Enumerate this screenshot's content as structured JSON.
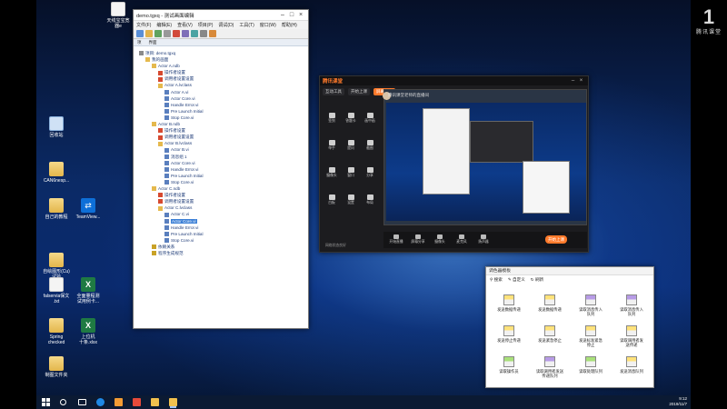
{
  "watermark": {
    "main": "1",
    "sub": "腾讯课堂"
  },
  "desktop_icons": [
    {
      "label": "天线宝宝宽\n器e",
      "type": "doc"
    },
    {
      "label": "回收站",
      "type": "recycle"
    },
    {
      "label": "CAN6nesp...",
      "type": "folder"
    },
    {
      "label": "自己的教程",
      "type": "folder"
    },
    {
      "label": "TeamView...",
      "type": "tv"
    },
    {
      "label": "自绘图形(Cu)\n试验",
      "type": "folder"
    },
    {
      "label": "falservia保文\n.txt",
      "type": "doc"
    },
    {
      "label": "全面量程测\n试用例卡...",
      "type": "excel"
    },
    {
      "label": "Spring\nchecked",
      "type": "folder"
    },
    {
      "label": "上位机\n十条.xlsx",
      "type": "excel"
    },
    {
      "label": "制图文件夹",
      "type": "folder"
    }
  ],
  "tree_window": {
    "title": "demo.tgxq - 测试画面编辑",
    "menus": [
      "文件(F)",
      "编辑(E)",
      "查看(V)",
      "项目(P)",
      "调试(D)",
      "工具(T)",
      "窗口(W)",
      "帮助(H)"
    ],
    "tabs": [
      "项",
      "界面"
    ],
    "nodes": [
      {
        "depth": 0,
        "label": "项目: demo.tgxq",
        "icon": "root"
      },
      {
        "depth": 1,
        "label": "我的画面",
        "icon": "folder"
      },
      {
        "depth": 2,
        "label": "Actor A.ndb",
        "icon": "folder"
      },
      {
        "depth": 3,
        "label": "操作者设置",
        "icon": "flag"
      },
      {
        "depth": 3,
        "label": "调用者设置设置",
        "icon": "flag"
      },
      {
        "depth": 3,
        "label": "Actor A.lvclass",
        "icon": "folder"
      },
      {
        "depth": 4,
        "label": "Actor A.vi",
        "icon": "leaf"
      },
      {
        "depth": 4,
        "label": "Actor Core.vi",
        "icon": "leaf"
      },
      {
        "depth": 4,
        "label": "Handle Error.vi",
        "icon": "leaf"
      },
      {
        "depth": 4,
        "label": "Pre Launch Initial",
        "icon": "leaf"
      },
      {
        "depth": 4,
        "label": "Stop Core.vi",
        "icon": "leaf"
      },
      {
        "depth": 2,
        "label": "Actor B.ndb",
        "icon": "folder"
      },
      {
        "depth": 3,
        "label": "操作者设置",
        "icon": "flag"
      },
      {
        "depth": 3,
        "label": "调用者设置设置",
        "icon": "flag"
      },
      {
        "depth": 3,
        "label": "Actor B.lvclass",
        "icon": "folder"
      },
      {
        "depth": 4,
        "label": "Actor B.vi",
        "icon": "leaf"
      },
      {
        "depth": 4,
        "label": "消息组 1",
        "icon": "leaf"
      },
      {
        "depth": 4,
        "label": "Actor Core.vi",
        "icon": "leaf"
      },
      {
        "depth": 4,
        "label": "Handle Error.vi",
        "icon": "leaf"
      },
      {
        "depth": 4,
        "label": "Pre Launch Initial",
        "icon": "leaf"
      },
      {
        "depth": 4,
        "label": "Stop Core.vi",
        "icon": "leaf"
      },
      {
        "depth": 2,
        "label": "Actor C.ndb",
        "icon": "folder"
      },
      {
        "depth": 3,
        "label": "操作者设置",
        "icon": "flag"
      },
      {
        "depth": 3,
        "label": "调用者设置设置",
        "icon": "flag"
      },
      {
        "depth": 3,
        "label": "Actor C.lvclass",
        "icon": "folder"
      },
      {
        "depth": 4,
        "label": "Actor C.vi",
        "icon": "leaf"
      },
      {
        "depth": 4,
        "label": "Actor Core.vi",
        "icon": "leaf",
        "selected": true
      },
      {
        "depth": 4,
        "label": "Handle Error.vi",
        "icon": "leaf"
      },
      {
        "depth": 4,
        "label": "Pre Launch Initial",
        "icon": "leaf"
      },
      {
        "depth": 4,
        "label": "Stop Core.vi",
        "icon": "leaf"
      },
      {
        "depth": 2,
        "label": "依赖关系",
        "icon": "star"
      },
      {
        "depth": 2,
        "label": "程序生成规范",
        "icon": "star"
      }
    ]
  },
  "rec_window": {
    "app_name": "腾讯课堂",
    "nav": [
      "互动工具",
      "开始上课",
      "屏幕分享"
    ],
    "nav_active": 2,
    "streamer": "腾讯课堂老师的直播间",
    "sidebar_tools": [
      "签到",
      "答题卡",
      "画中画",
      "举手",
      "提问",
      "截图",
      "摄像头",
      "窗口",
      "分享",
      "白板",
      "设置",
      "布局"
    ],
    "bottom_tools": [
      "开始直播",
      "屏幕分享",
      "摄像头",
      "麦克风",
      "扬声器"
    ],
    "live_label": "开始上课",
    "status": "网络状态良好"
  },
  "tool_panel": {
    "title": "调色器模板",
    "tools": [
      "搜索",
      "自定义",
      "刷新"
    ],
    "items": [
      {
        "label": "发送数据传递",
        "color": "yellow"
      },
      {
        "label": "发送数据传递",
        "color": "yellow"
      },
      {
        "label": "读取消息传入\n队列",
        "color": "purple"
      },
      {
        "label": "读取消息传入\n队列",
        "color": "purple"
      },
      {
        "label": "发送停止传递",
        "color": "yellow"
      },
      {
        "label": "发送紧急停止",
        "color": "yellow"
      },
      {
        "label": "发送标准紧急\n停止",
        "color": "yellow"
      },
      {
        "label": "读取调用者发\n送传递",
        "color": "yellow"
      },
      {
        "label": "读取操作员",
        "color": "green"
      },
      {
        "label": "读取调用者发送\n传递队列",
        "color": "purple"
      },
      {
        "label": "读取处理队列",
        "color": "green"
      },
      {
        "label": "发送消息队列",
        "color": "yellow"
      }
    ]
  },
  "taskbar": {
    "time": "9:12",
    "date": "2019/11/7"
  }
}
